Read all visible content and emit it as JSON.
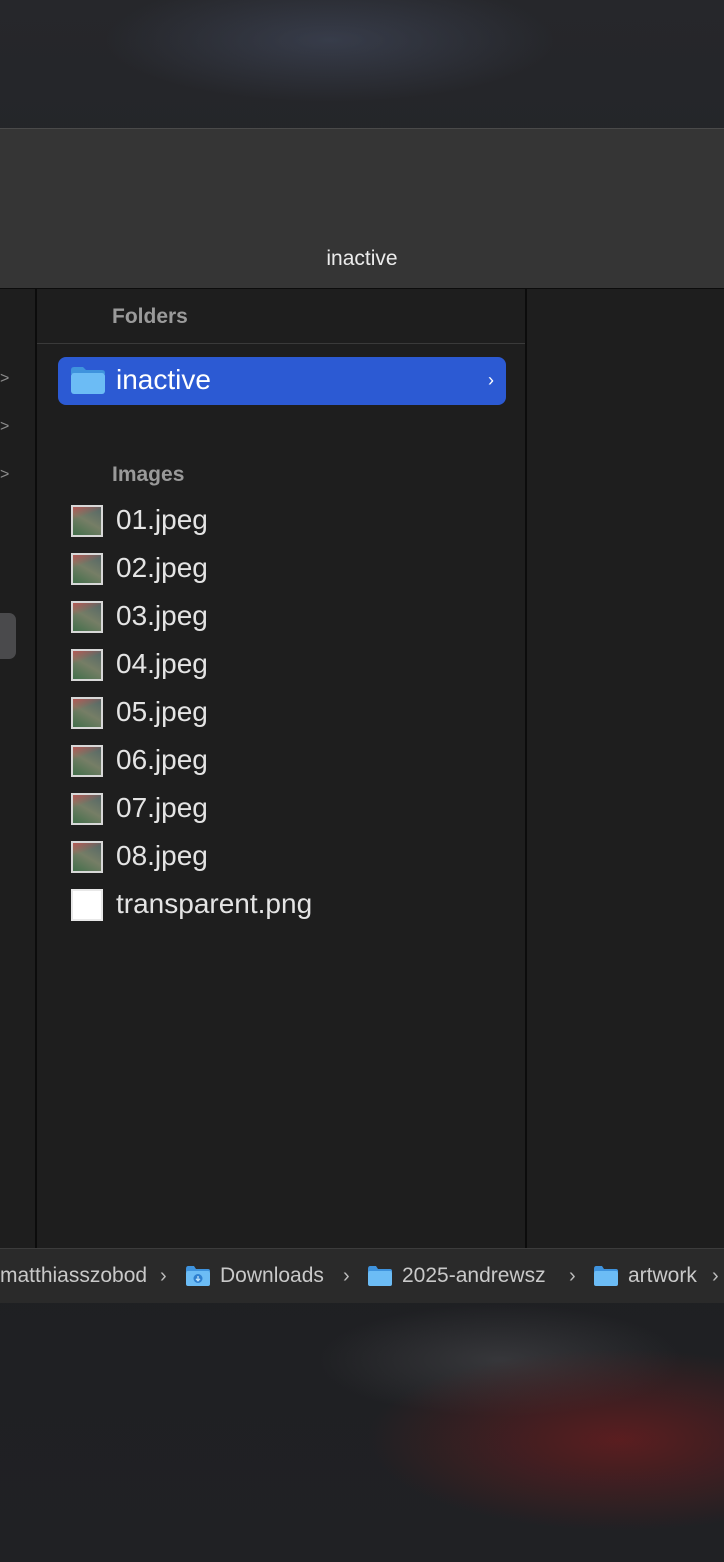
{
  "window": {
    "title": "inactive"
  },
  "left_column": {
    "chevrons": [
      ">",
      ">",
      ">"
    ]
  },
  "main_column": {
    "folders_header": "Folders",
    "selected_folder": {
      "name": "inactive",
      "icon": "folder-icon",
      "chevron": "›",
      "highlight_color": "#2c5ad3"
    },
    "images_header": "Images",
    "files": [
      {
        "name": "01.jpeg",
        "icon": "image-thumbnail-icon"
      },
      {
        "name": "02.jpeg",
        "icon": "image-thumbnail-icon"
      },
      {
        "name": "03.jpeg",
        "icon": "image-thumbnail-icon"
      },
      {
        "name": "04.jpeg",
        "icon": "image-thumbnail-icon"
      },
      {
        "name": "05.jpeg",
        "icon": "image-thumbnail-icon"
      },
      {
        "name": "06.jpeg",
        "icon": "image-thumbnail-icon"
      },
      {
        "name": "07.jpeg",
        "icon": "image-thumbnail-icon"
      },
      {
        "name": "08.jpeg",
        "icon": "image-thumbnail-icon"
      },
      {
        "name": "transparent.png",
        "icon": "blank-image-icon"
      }
    ]
  },
  "path_bar": {
    "segments": [
      {
        "label": "matthiasszobod",
        "icon": null
      },
      {
        "label": "Downloads",
        "icon": "downloads-folder-icon"
      },
      {
        "label": "2025-andrewsz",
        "icon": "folder-icon"
      },
      {
        "label": "artwork",
        "icon": "folder-icon"
      }
    ],
    "separator": "›",
    "folder_color": "#5aaef0"
  }
}
